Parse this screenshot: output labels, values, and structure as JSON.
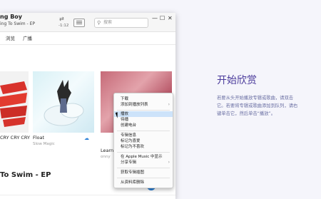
{
  "window": {
    "now_playing_title": "ng Boy",
    "now_playing_subtitle": "ing To Swim - EP",
    "time_remaining": "-1:12",
    "search_placeholder": "搜索"
  },
  "tabs": [
    {
      "label": "浏览"
    },
    {
      "label": "广播"
    }
  ],
  "albums": [
    {
      "title": "CRY CRY CRY",
      "artist": ""
    },
    {
      "title": "Float",
      "artist": "Slow Magic"
    },
    {
      "title": "Learnin",
      "artist": "onny"
    }
  ],
  "section_title": "To Swim - EP",
  "context_menu": {
    "items": [
      {
        "label": "下载",
        "submenu": false,
        "highlighted": false
      },
      {
        "label": "添加到播放列表",
        "submenu": true,
        "highlighted": false
      },
      {
        "label": "播放",
        "submenu": false,
        "highlighted": true
      },
      {
        "label": "待播",
        "submenu": false,
        "highlighted": false
      },
      {
        "label": "创建电台",
        "submenu": false,
        "highlighted": false
      },
      {
        "label": "专辑信息",
        "submenu": false,
        "highlighted": false
      },
      {
        "label": "标记为喜爱",
        "submenu": false,
        "highlighted": false
      },
      {
        "label": "标记为不喜欢",
        "submenu": false,
        "highlighted": false
      },
      {
        "label": "在 Apple Music 中显示",
        "submenu": false,
        "highlighted": false
      },
      {
        "label": "分享专辑",
        "submenu": true,
        "highlighted": false
      },
      {
        "label": "获取专辑插图",
        "submenu": false,
        "highlighted": false
      },
      {
        "label": "从资料库删除",
        "submenu": false,
        "highlighted": false
      }
    ]
  },
  "info": {
    "heading": "开始欣赏",
    "lines": [
      "若要从头开始播放专辑或歌曲，请双击",
      "它。若要将专辑或歌曲添加到队列，请右",
      "键单击它，然后单击“播放”。"
    ]
  },
  "colors": {
    "accent": "#2a7fd6",
    "heading": "#4a3a9b",
    "menu_highlight": "#cde3fa"
  }
}
